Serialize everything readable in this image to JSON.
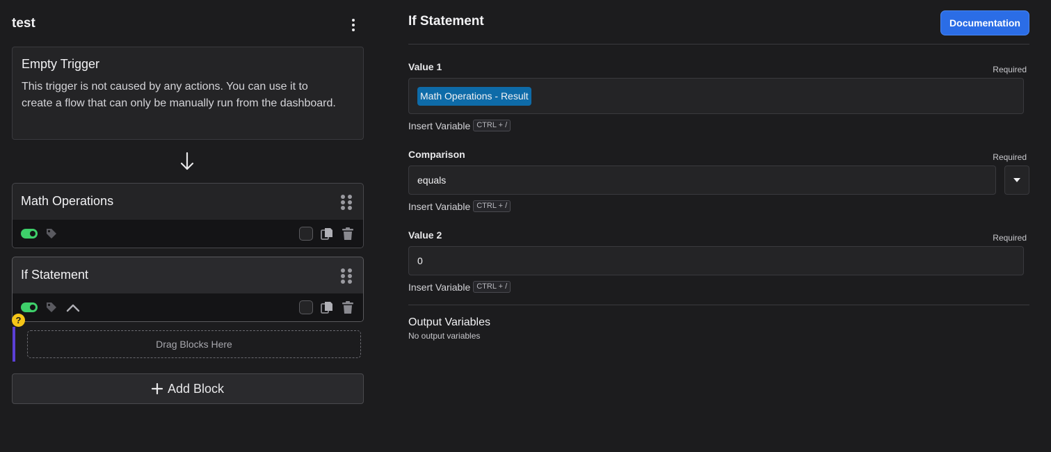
{
  "flow": {
    "title": "test",
    "trigger": {
      "title": "Empty Trigger",
      "description": "This trigger is not caused by any actions. You can use it to create a flow that can only be manually run from the dashboard."
    },
    "blocks": [
      {
        "title": "Math Operations",
        "enabled": true
      },
      {
        "title": "If Statement",
        "enabled": true,
        "expanded": true
      }
    ],
    "drop_zone_label": "Drag Blocks Here",
    "help_badge": "?",
    "add_block_label": "Add Block"
  },
  "panel": {
    "title": "If Statement",
    "documentation_label": "Documentation",
    "fields": [
      {
        "label": "Value 1",
        "required_label": "Required",
        "chip": "Math Operations - Result"
      },
      {
        "label": "Comparison",
        "required_label": "Required",
        "value": "equals"
      },
      {
        "label": "Value 2",
        "required_label": "Required",
        "value": "0"
      }
    ],
    "insert_variable_label": "Insert Variable",
    "insert_variable_shortcut": "CTRL + /",
    "output": {
      "title": "Output Variables",
      "empty": "No output variables"
    }
  },
  "colors": {
    "background": "#1c1c1e",
    "toggle_on": "#3ecf6a",
    "primary_button": "#2b6de6",
    "variable_chip": "#0e6ba8",
    "nested_bar": "#5b3fd6",
    "help_badge": "#f5c518"
  }
}
